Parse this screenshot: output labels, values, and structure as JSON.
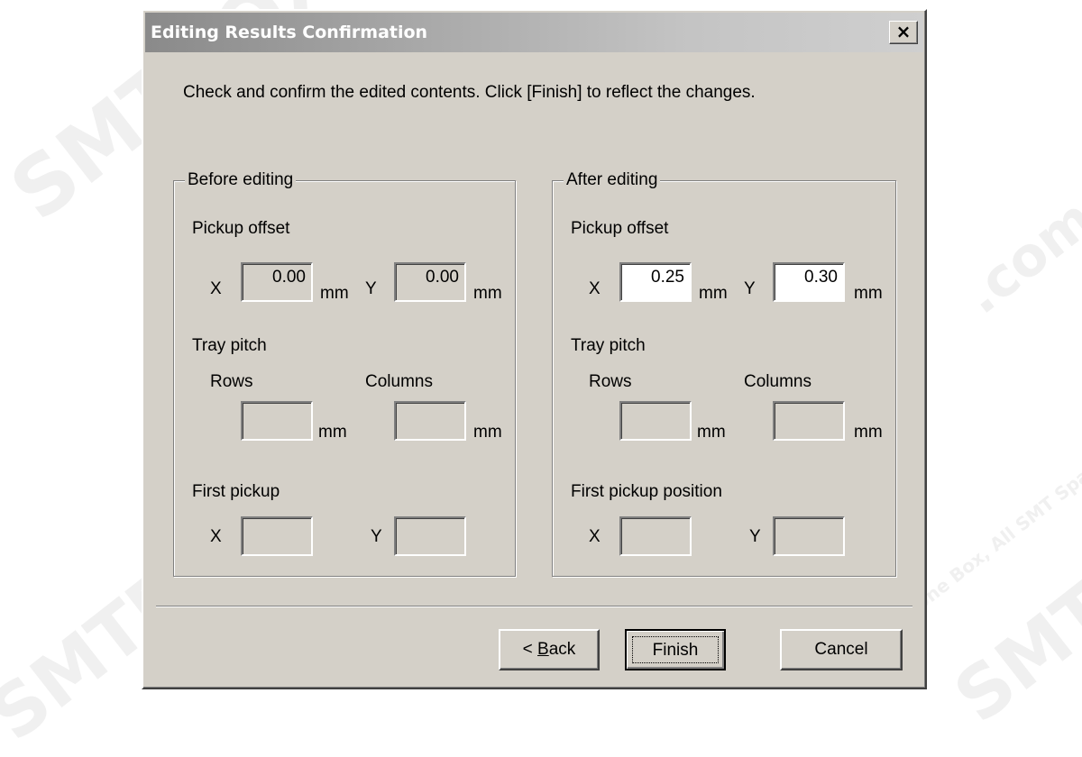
{
  "dialog": {
    "title": "Editing Results Confirmation",
    "close_glyph": "×",
    "instruction": "Check and confirm the edited contents.  Click [Finish] to reflect the changes."
  },
  "before": {
    "legend": "Before editing",
    "pickup_offset_label": "Pickup offset",
    "x_label": "X",
    "y_label": "Y",
    "x_value": "0.00",
    "y_value": "0.00",
    "unit": "mm",
    "tray_pitch_label": "Tray pitch",
    "rows_label": "Rows",
    "columns_label": "Columns",
    "rows_value": "",
    "columns_value": "",
    "first_pickup_label": "First pickup",
    "first_x_value": "",
    "first_y_value": ""
  },
  "after": {
    "legend": "After editing",
    "pickup_offset_label": "Pickup offset",
    "x_label": "X",
    "y_label": "Y",
    "x_value": "0.25",
    "y_value": "0.30",
    "unit": "mm",
    "tray_pitch_label": "Tray pitch",
    "rows_label": "Rows",
    "columns_label": "Columns",
    "rows_value": "",
    "columns_value": "",
    "first_pickup_label": "First pickup position",
    "first_x_value": "",
    "first_y_value": ""
  },
  "buttons": {
    "back_prefix": "< ",
    "back_accel": "B",
    "back_rest": "ack",
    "finish": "Finish",
    "cancel": "Cancel"
  },
  "watermark": {
    "brand": "SMTBOX",
    "domain": ".com",
    "slogan": "One Box, All SMT Spare Parts"
  }
}
